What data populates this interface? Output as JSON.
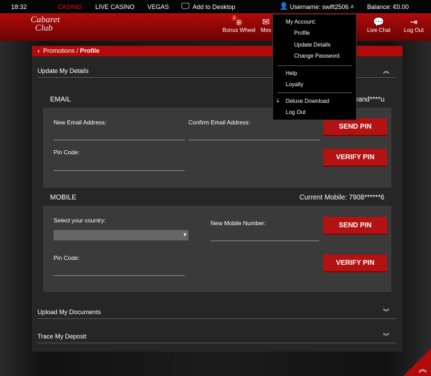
{
  "topbar": {
    "time": "18:32",
    "nav": [
      "CASINO",
      "LIVE CASINO",
      "VEGAS"
    ],
    "add_to_desktop": "Add to Desktop",
    "username": "Username: swift2506",
    "balance": "Balance: €0.00"
  },
  "header": {
    "logo": "Cabaret Club",
    "bonus_wheel": "Bonus Wheel",
    "bonus_badge": "1",
    "messages": "Mes",
    "live_chat": "Live Chat",
    "log_out": "Log Out"
  },
  "breadcrumb": {
    "parent": "Promotions",
    "sep": " / ",
    "current": "Profile"
  },
  "sections": {
    "update": "Update My Details",
    "upload": "Upload My Documents",
    "trace": "Trace My Deposit"
  },
  "email": {
    "title": "EMAIL",
    "current": "vand****u",
    "new_label": "New Email Address:",
    "confirm_label": "Confirm Email Address:",
    "pin_label": "Pin Code:",
    "send_pin": "SEND PIN",
    "verify_pin": "VERIFY PIN"
  },
  "mobile": {
    "title": "MOBILE",
    "current": "Current Mobile: 7908******6",
    "country_label": "Select your country:",
    "country_value": "",
    "number_label": "New Mobile Number:",
    "pin_label": "Pin Code:",
    "send_pin": "SEND PIN",
    "verify_pin": "VERIFY PIN"
  },
  "dropdown": {
    "heading": "My Account:",
    "items": [
      "Profile",
      "Update Details",
      "Change Password"
    ],
    "help": "Help",
    "loyalty": "Loyalty",
    "download": "Deluxe Download",
    "logout": "Log Out"
  },
  "colors": {
    "accent": "#b20a0a",
    "panel": "#262626",
    "box": "#3a3a3a"
  }
}
